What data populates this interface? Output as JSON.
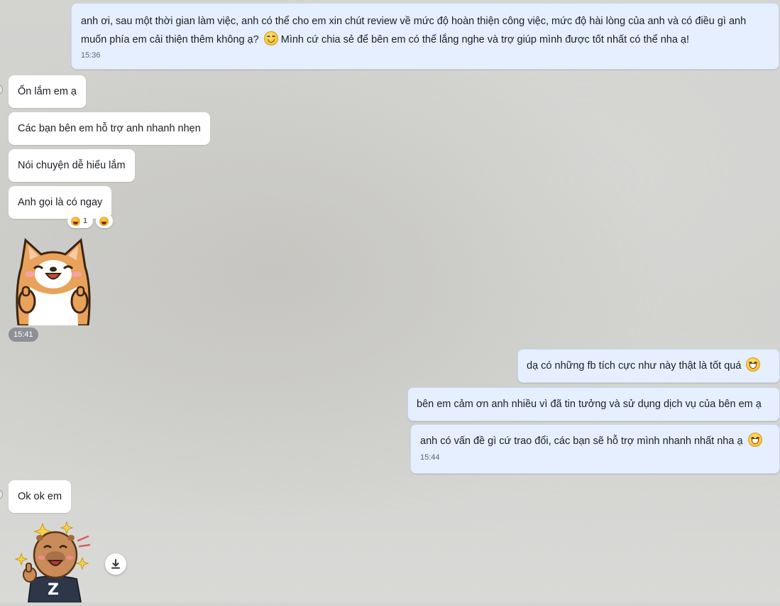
{
  "messages": {
    "top_out": {
      "line1": "anh ơi, sau một thời gian làm việc, anh có thể cho em xin chút review về mức độ hoàn thiện công việc, mức độ hài lòng của anh và có điều gì anh",
      "line2": "muốn phía em cải thiện thêm không ạ?",
      "line2_end": "Mình cứ chia sẻ để bên em có thể lắng nghe và trợ giúp mình được tốt nhất có thể nha ạ!",
      "time": "15:36"
    },
    "in_1": "Ổn lắm em ạ",
    "in_2": "Các bạn bên em hỗ trợ anh nhanh nhẹn",
    "in_3": "Nói chuyện dễ hiểu lắm",
    "in_4": "Anh gọi là có ngay",
    "reaction_count": "1",
    "sticker_time": "15:41",
    "out_1": "dạ có những fb tích cực như này thật là tốt quá",
    "out_2": "bên em cảm ơn anh nhiều vì đã tin tưởng và sử dụng dịch vụ của bên em ạ",
    "out_3": "anh có vấn đề gì cứ trao đổi, các bạn sẽ hỗ trợ mình nhanh nhất nha ạ",
    "out_3_time": "15:44",
    "in_5": "Ok ok em",
    "sticker2_badge": "Z"
  },
  "colors": {
    "incoming_bubble": "#ffffff",
    "outgoing_bubble": "#e5efff",
    "time_pill": "#8d9195"
  },
  "icons": [
    "blush-smile-emoji-icon",
    "grin-emoji-icon",
    "laugh-reaction-icon",
    "download-icon",
    "shiba-thumbs-up-sticker",
    "capybara-thumbs-up-sticker"
  ]
}
